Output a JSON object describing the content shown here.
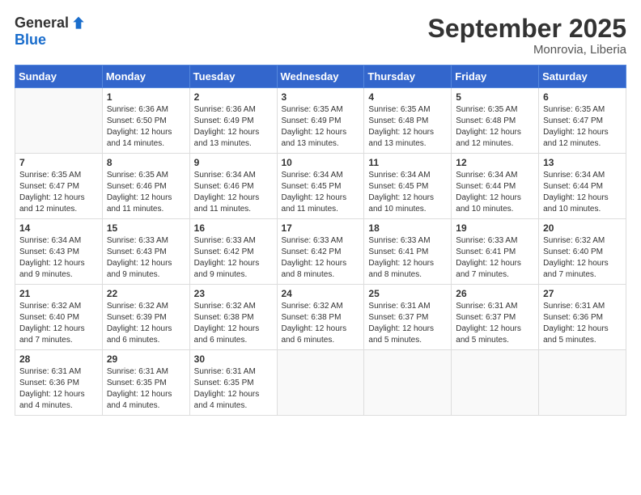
{
  "logo": {
    "general": "General",
    "blue": "Blue"
  },
  "header": {
    "month": "September 2025",
    "location": "Monrovia, Liberia"
  },
  "weekdays": [
    "Sunday",
    "Monday",
    "Tuesday",
    "Wednesday",
    "Thursday",
    "Friday",
    "Saturday"
  ],
  "weeks": [
    [
      {
        "day": "",
        "sunrise": "",
        "sunset": "",
        "daylight": ""
      },
      {
        "day": "1",
        "sunrise": "Sunrise: 6:36 AM",
        "sunset": "Sunset: 6:50 PM",
        "daylight": "Daylight: 12 hours and 14 minutes."
      },
      {
        "day": "2",
        "sunrise": "Sunrise: 6:36 AM",
        "sunset": "Sunset: 6:49 PM",
        "daylight": "Daylight: 12 hours and 13 minutes."
      },
      {
        "day": "3",
        "sunrise": "Sunrise: 6:35 AM",
        "sunset": "Sunset: 6:49 PM",
        "daylight": "Daylight: 12 hours and 13 minutes."
      },
      {
        "day": "4",
        "sunrise": "Sunrise: 6:35 AM",
        "sunset": "Sunset: 6:48 PM",
        "daylight": "Daylight: 12 hours and 13 minutes."
      },
      {
        "day": "5",
        "sunrise": "Sunrise: 6:35 AM",
        "sunset": "Sunset: 6:48 PM",
        "daylight": "Daylight: 12 hours and 12 minutes."
      },
      {
        "day": "6",
        "sunrise": "Sunrise: 6:35 AM",
        "sunset": "Sunset: 6:47 PM",
        "daylight": "Daylight: 12 hours and 12 minutes."
      }
    ],
    [
      {
        "day": "7",
        "sunrise": "Sunrise: 6:35 AM",
        "sunset": "Sunset: 6:47 PM",
        "daylight": "Daylight: 12 hours and 12 minutes."
      },
      {
        "day": "8",
        "sunrise": "Sunrise: 6:35 AM",
        "sunset": "Sunset: 6:46 PM",
        "daylight": "Daylight: 12 hours and 11 minutes."
      },
      {
        "day": "9",
        "sunrise": "Sunrise: 6:34 AM",
        "sunset": "Sunset: 6:46 PM",
        "daylight": "Daylight: 12 hours and 11 minutes."
      },
      {
        "day": "10",
        "sunrise": "Sunrise: 6:34 AM",
        "sunset": "Sunset: 6:45 PM",
        "daylight": "Daylight: 12 hours and 11 minutes."
      },
      {
        "day": "11",
        "sunrise": "Sunrise: 6:34 AM",
        "sunset": "Sunset: 6:45 PM",
        "daylight": "Daylight: 12 hours and 10 minutes."
      },
      {
        "day": "12",
        "sunrise": "Sunrise: 6:34 AM",
        "sunset": "Sunset: 6:44 PM",
        "daylight": "Daylight: 12 hours and 10 minutes."
      },
      {
        "day": "13",
        "sunrise": "Sunrise: 6:34 AM",
        "sunset": "Sunset: 6:44 PM",
        "daylight": "Daylight: 12 hours and 10 minutes."
      }
    ],
    [
      {
        "day": "14",
        "sunrise": "Sunrise: 6:34 AM",
        "sunset": "Sunset: 6:43 PM",
        "daylight": "Daylight: 12 hours and 9 minutes."
      },
      {
        "day": "15",
        "sunrise": "Sunrise: 6:33 AM",
        "sunset": "Sunset: 6:43 PM",
        "daylight": "Daylight: 12 hours and 9 minutes."
      },
      {
        "day": "16",
        "sunrise": "Sunrise: 6:33 AM",
        "sunset": "Sunset: 6:42 PM",
        "daylight": "Daylight: 12 hours and 9 minutes."
      },
      {
        "day": "17",
        "sunrise": "Sunrise: 6:33 AM",
        "sunset": "Sunset: 6:42 PM",
        "daylight": "Daylight: 12 hours and 8 minutes."
      },
      {
        "day": "18",
        "sunrise": "Sunrise: 6:33 AM",
        "sunset": "Sunset: 6:41 PM",
        "daylight": "Daylight: 12 hours and 8 minutes."
      },
      {
        "day": "19",
        "sunrise": "Sunrise: 6:33 AM",
        "sunset": "Sunset: 6:41 PM",
        "daylight": "Daylight: 12 hours and 7 minutes."
      },
      {
        "day": "20",
        "sunrise": "Sunrise: 6:32 AM",
        "sunset": "Sunset: 6:40 PM",
        "daylight": "Daylight: 12 hours and 7 minutes."
      }
    ],
    [
      {
        "day": "21",
        "sunrise": "Sunrise: 6:32 AM",
        "sunset": "Sunset: 6:40 PM",
        "daylight": "Daylight: 12 hours and 7 minutes."
      },
      {
        "day": "22",
        "sunrise": "Sunrise: 6:32 AM",
        "sunset": "Sunset: 6:39 PM",
        "daylight": "Daylight: 12 hours and 6 minutes."
      },
      {
        "day": "23",
        "sunrise": "Sunrise: 6:32 AM",
        "sunset": "Sunset: 6:38 PM",
        "daylight": "Daylight: 12 hours and 6 minutes."
      },
      {
        "day": "24",
        "sunrise": "Sunrise: 6:32 AM",
        "sunset": "Sunset: 6:38 PM",
        "daylight": "Daylight: 12 hours and 6 minutes."
      },
      {
        "day": "25",
        "sunrise": "Sunrise: 6:31 AM",
        "sunset": "Sunset: 6:37 PM",
        "daylight": "Daylight: 12 hours and 5 minutes."
      },
      {
        "day": "26",
        "sunrise": "Sunrise: 6:31 AM",
        "sunset": "Sunset: 6:37 PM",
        "daylight": "Daylight: 12 hours and 5 minutes."
      },
      {
        "day": "27",
        "sunrise": "Sunrise: 6:31 AM",
        "sunset": "Sunset: 6:36 PM",
        "daylight": "Daylight: 12 hours and 5 minutes."
      }
    ],
    [
      {
        "day": "28",
        "sunrise": "Sunrise: 6:31 AM",
        "sunset": "Sunset: 6:36 PM",
        "daylight": "Daylight: 12 hours and 4 minutes."
      },
      {
        "day": "29",
        "sunrise": "Sunrise: 6:31 AM",
        "sunset": "Sunset: 6:35 PM",
        "daylight": "Daylight: 12 hours and 4 minutes."
      },
      {
        "day": "30",
        "sunrise": "Sunrise: 6:31 AM",
        "sunset": "Sunset: 6:35 PM",
        "daylight": "Daylight: 12 hours and 4 minutes."
      },
      {
        "day": "",
        "sunrise": "",
        "sunset": "",
        "daylight": ""
      },
      {
        "day": "",
        "sunrise": "",
        "sunset": "",
        "daylight": ""
      },
      {
        "day": "",
        "sunrise": "",
        "sunset": "",
        "daylight": ""
      },
      {
        "day": "",
        "sunrise": "",
        "sunset": "",
        "daylight": ""
      }
    ]
  ]
}
